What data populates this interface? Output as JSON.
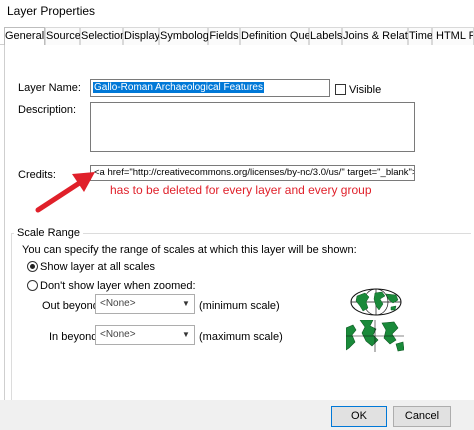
{
  "window": {
    "title": "Layer Properties"
  },
  "tabs": [
    {
      "label": "General",
      "active": true
    },
    {
      "label": "Source"
    },
    {
      "label": "Selection"
    },
    {
      "label": "Display"
    },
    {
      "label": "Symbology"
    },
    {
      "label": "Fields"
    },
    {
      "label": "Definition Query"
    },
    {
      "label": "Labels"
    },
    {
      "label": "Joins & Relates"
    },
    {
      "label": "Time"
    },
    {
      "label": "HTML Pop"
    }
  ],
  "general": {
    "layer_name_label": "Layer Name:",
    "layer_name_value": "Gallo-Roman Archaeological Features",
    "visible_label": "Visible",
    "visible_checked": false,
    "description_label": "Description:",
    "description_value": "",
    "credits_label": "Credits:",
    "credits_value": "<a href=\"http://creativecommons.org/licenses/by-nc/3.0/us/\" target=\"_blank\">Crea"
  },
  "annotation": {
    "text": "has to be deleted for every layer and every group",
    "color": "#e0202a"
  },
  "scale_range": {
    "group_title": "Scale Range",
    "intro": "You can specify the range of scales at which this layer will be shown:",
    "option_all": "Show layer at all scales",
    "option_zoomed": "Don't show layer when zoomed:",
    "selected": "all",
    "out_beyond_label": "Out beyond:",
    "out_beyond_value": "<None>",
    "out_beyond_hint": "(minimum scale)",
    "in_beyond_label": "In beyond:",
    "in_beyond_value": "<None>",
    "in_beyond_hint": "(maximum scale)"
  },
  "buttons": {
    "ok": "OK",
    "cancel": "Cancel"
  },
  "colors": {
    "selection": "#0078d7",
    "annotation": "#e0202a"
  }
}
